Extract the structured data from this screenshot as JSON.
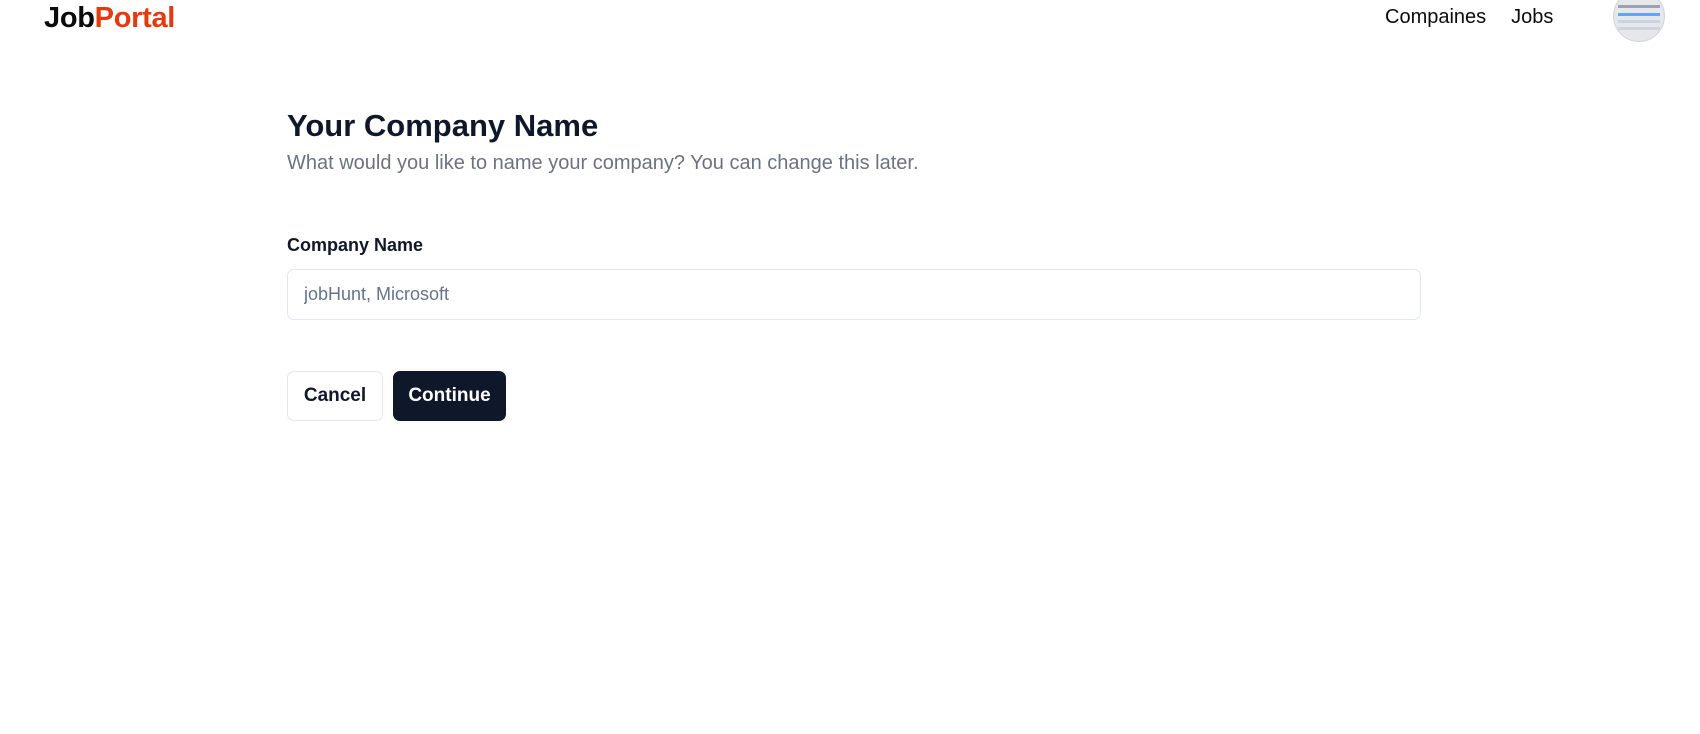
{
  "navbar": {
    "logo_primary": "Job",
    "logo_accent": "Portal",
    "links": [
      "Compaines",
      "Jobs"
    ]
  },
  "page": {
    "title": "Your Company Name",
    "subtitle": "What would you like to name your company? You can change this later."
  },
  "form": {
    "company_label": "Company Name",
    "company_value": "",
    "company_placeholder": "jobHunt, Microsoft",
    "cancel_label": "Cancel",
    "continue_label": "Continue"
  },
  "colors": {
    "accent": "#e8380d",
    "primary_button": "#0f172a",
    "muted_text": "#6b7280"
  },
  "icons": {
    "avatar": "user-avatar-image"
  }
}
